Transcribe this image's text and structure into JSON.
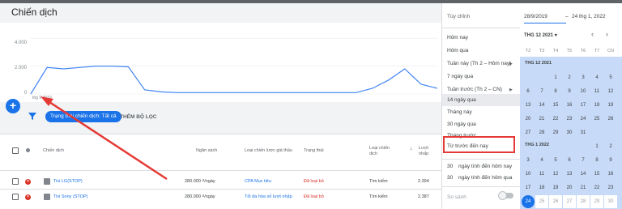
{
  "page": {
    "title": "Chiến dịch"
  },
  "chart": {
    "y_ticks": [
      "4.000",
      "2.000",
      "0"
    ],
    "x_tick": "thg 9 2019"
  },
  "chart_data": {
    "type": "line",
    "title": "",
    "xlabel": "",
    "ylabel": "",
    "ylim": [
      0,
      5000
    ],
    "x_start_label": "thg 9 2019",
    "series": [
      {
        "values": [
          0,
          1900,
          1800,
          1900,
          2000,
          2000,
          1950,
          300,
          150,
          100,
          100,
          100,
          100,
          100,
          100,
          100,
          100,
          100,
          100,
          100,
          100,
          400,
          1000,
          1800,
          700,
          400
        ]
      }
    ]
  },
  "filters": {
    "chip_label": "Trạng thái chiến dịch: Tất cả",
    "add_filter": "THÊM BỘ LỌC"
  },
  "table": {
    "headers": {
      "campaign": "Chiến dịch",
      "budget": "Ngân sách",
      "bid_strategy": "Loại chiến lược giá thầu",
      "status": "Trạng thái",
      "campaign_type": "Loại chiến dịch",
      "clicks": "Lượt nhấp"
    },
    "rows": [
      {
        "name": "Tivi LG(STOP)",
        "budget": "280.000 ₫/ngày",
        "bid_strategy": "CPA Mục tiêu",
        "status": "Đã loại bỏ",
        "type": "Tìm kiếm",
        "clicks": "2.394"
      },
      {
        "name": "Tivi Sony (STOP)",
        "budget": "280.000 ₫/ngày",
        "bid_strategy": "Tối đa hóa số lượt nhấp",
        "status": "Đã loại bỏ",
        "type": "Tìm kiếm",
        "clicks": "2.387"
      }
    ]
  },
  "date_menu": {
    "custom": "Tùy chỉnh",
    "items": [
      "Hôm nay",
      "Hôm qua",
      "Tuần này (Th 2 – Hôm nay)",
      "7 ngày qua",
      "Tuần trước (Th 2 – CN)",
      "14 ngày qua",
      "Tháng này",
      "30 ngày qua",
      "Tháng trước",
      "Từ trước đến nay"
    ],
    "days_to_today_value": "30",
    "days_to_today": "ngày tính đến hôm nay",
    "days_to_yesterday_value": "30",
    "days_to_yesterday": "ngày tính đến hôm qua",
    "compare": "So sánh"
  },
  "calendar": {
    "start_date": "28/9/2019",
    "dash": "–",
    "end_date": "24 thg 1, 2022",
    "month_select": "THG 12 2021",
    "prev": "‹",
    "next": "›",
    "weekdays": [
      "T2",
      "T3",
      "T4",
      "T5",
      "T6",
      "T7",
      "CN"
    ],
    "dec_label": "THG 12 2021",
    "jan_label": "THG 1 2022",
    "dec_days": [
      "1",
      "2",
      "3",
      "4",
      "5",
      "6",
      "7",
      "8",
      "9",
      "10",
      "11",
      "12",
      "13",
      "14",
      "15",
      "16",
      "17",
      "18",
      "19",
      "20",
      "21",
      "22",
      "23",
      "24",
      "25",
      "26",
      "27",
      "28",
      "29",
      "30",
      "31"
    ],
    "jan_days": [
      "1",
      "2",
      "3",
      "4",
      "5",
      "6",
      "7",
      "8",
      "9",
      "10",
      "11",
      "12",
      "13",
      "14",
      "15",
      "16",
      "17",
      "18",
      "19",
      "20",
      "21",
      "22",
      "23",
      "24",
      "25",
      "26",
      "27",
      "28",
      "29",
      "30"
    ],
    "selected_end": "24"
  },
  "colors": {
    "accent": "#1a73e8",
    "range": "#c7daf7",
    "highlight": "#e53935",
    "status_removed": "#d93025"
  }
}
